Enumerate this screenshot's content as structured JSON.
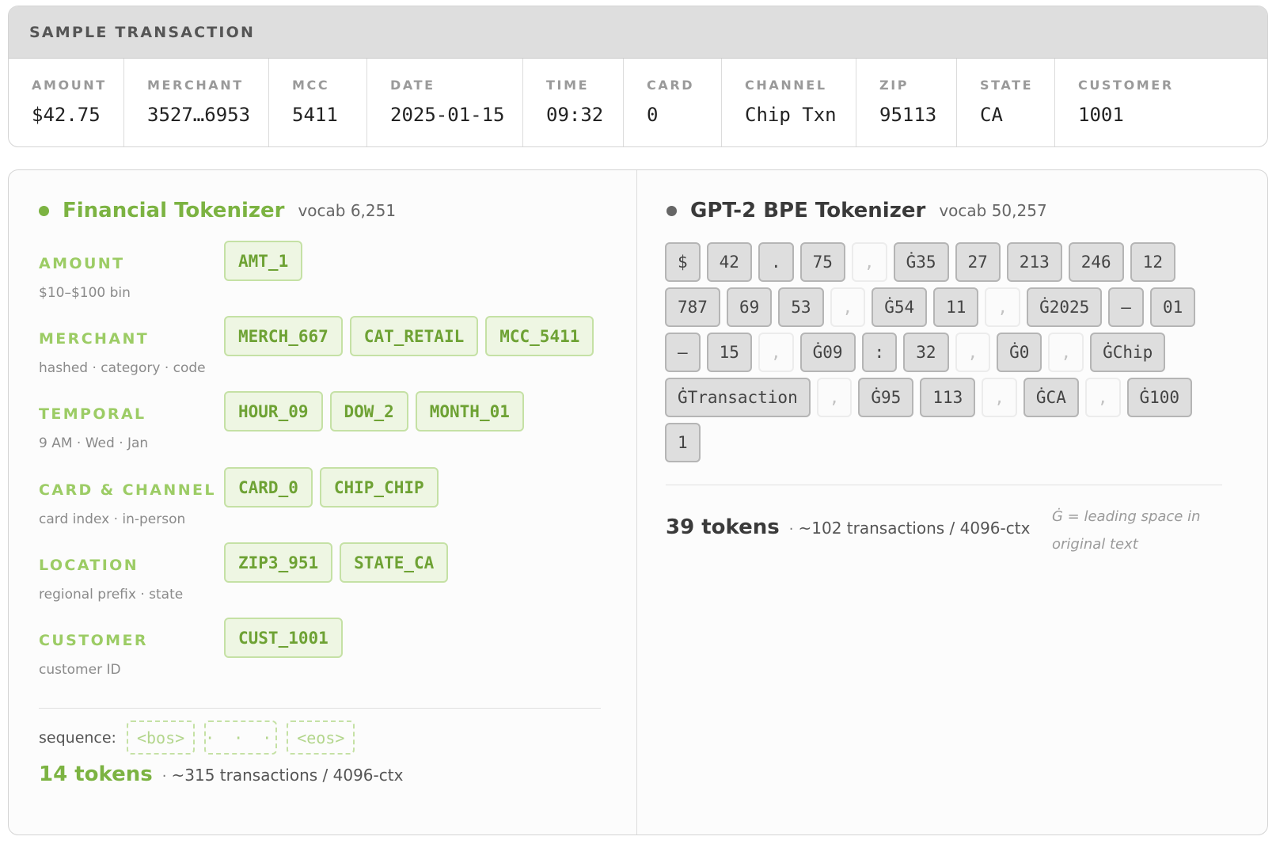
{
  "sample_transaction": {
    "title": "SAMPLE TRANSACTION",
    "fields": [
      {
        "label": "AMOUNT",
        "value": "$42.75"
      },
      {
        "label": "MERCHANT",
        "value": "3527…6953"
      },
      {
        "label": "MCC",
        "value": "5411"
      },
      {
        "label": "DATE",
        "value": "2025-01-15"
      },
      {
        "label": "TIME",
        "value": "09:32"
      },
      {
        "label": "CARD",
        "value": "0"
      },
      {
        "label": "CHANNEL",
        "value": "Chip Txn"
      },
      {
        "label": "ZIP",
        "value": "95113"
      },
      {
        "label": "STATE",
        "value": "CA"
      },
      {
        "label": "CUSTOMER",
        "value": "1001"
      }
    ]
  },
  "financial": {
    "title": "Financial Tokenizer",
    "vocab": "vocab 6,251",
    "rows": [
      {
        "label": "AMOUNT",
        "sub": "$10–$100 bin",
        "tokens": [
          "AMT_1"
        ]
      },
      {
        "label": "MERCHANT",
        "sub": "hashed · category · code",
        "tokens": [
          "MERCH_667",
          "CAT_RETAIL",
          "MCC_5411"
        ]
      },
      {
        "label": "TEMPORAL",
        "sub": "9 AM · Wed · Jan",
        "tokens": [
          "HOUR_09",
          "DOW_2",
          "MONTH_01"
        ]
      },
      {
        "label": "CARD & CHANNEL",
        "sub": "card index · in-person",
        "tokens": [
          "CARD_0",
          "CHIP_CHIP"
        ]
      },
      {
        "label": "LOCATION",
        "sub": "regional prefix · state",
        "tokens": [
          "ZIP3_951",
          "STATE_CA"
        ]
      },
      {
        "label": "CUSTOMER",
        "sub": "customer ID",
        "tokens": [
          "CUST_1001"
        ]
      }
    ],
    "sequence": {
      "label": "sequence:",
      "tokens": [
        "<bos>",
        "· · ·",
        "<eos>"
      ]
    },
    "token_count": "14 tokens",
    "separator": "·",
    "capacity": "~315 transactions / 4096-ctx"
  },
  "gpt2": {
    "title": "GPT-2 BPE Tokenizer",
    "vocab": "vocab 50,257",
    "tokens": [
      {
        "t": "$"
      },
      {
        "t": "42"
      },
      {
        "t": "."
      },
      {
        "t": "75"
      },
      {
        "t": ",",
        "faint": true
      },
      {
        "t": "Ġ35"
      },
      {
        "t": "27"
      },
      {
        "t": "213"
      },
      {
        "t": "246"
      },
      {
        "t": "12"
      },
      {
        "t": "787"
      },
      {
        "t": "69"
      },
      {
        "t": "53"
      },
      {
        "t": ",",
        "faint": true
      },
      {
        "t": "Ġ54"
      },
      {
        "t": "11"
      },
      {
        "t": ",",
        "faint": true
      },
      {
        "t": "Ġ2025"
      },
      {
        "t": "–"
      },
      {
        "t": "01"
      },
      {
        "t": "–"
      },
      {
        "t": "15"
      },
      {
        "t": ",",
        "faint": true
      },
      {
        "t": "Ġ09"
      },
      {
        "t": ":"
      },
      {
        "t": "32"
      },
      {
        "t": ",",
        "faint": true
      },
      {
        "t": "Ġ0"
      },
      {
        "t": ",",
        "faint": true
      },
      {
        "t": "ĠChip"
      },
      {
        "t": "ĠTransaction"
      },
      {
        "t": ",",
        "faint": true
      },
      {
        "t": "Ġ95"
      },
      {
        "t": "113"
      },
      {
        "t": ",",
        "faint": true
      },
      {
        "t": "ĠCA"
      },
      {
        "t": ",",
        "faint": true
      },
      {
        "t": "Ġ100"
      },
      {
        "t": "1"
      }
    ],
    "token_count": "39 tokens",
    "separator": "·",
    "capacity": "~102 transactions / 4096-ctx",
    "note": "Ġ = leading space in original text"
  }
}
